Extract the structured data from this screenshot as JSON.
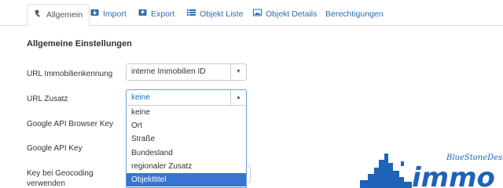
{
  "tabs": [
    {
      "label": "Allgemein",
      "icon": "wrench-icon",
      "active": true
    },
    {
      "label": "Import",
      "icon": "import-icon",
      "active": false
    },
    {
      "label": "Export",
      "icon": "export-icon",
      "active": false
    },
    {
      "label": "Objekt Liste",
      "icon": "list-icon",
      "active": false
    },
    {
      "label": "Objekt Details",
      "icon": "image-icon",
      "active": false
    },
    {
      "label": "Berechtigungen",
      "icon": "",
      "active": false
    }
  ],
  "section": {
    "title": "Allgemeine Einstellungen"
  },
  "fields": {
    "url_id": {
      "label": "URL Immobilienkennung",
      "value": "interne Immobilien ID"
    },
    "url_zusatz": {
      "label": "URL Zusatz",
      "value": "keine"
    },
    "google_browser_key": {
      "label": "Google API Browser Key"
    },
    "google_api_key": {
      "label": "Google API Key"
    },
    "geocoding": {
      "label": "Key bei Geocoding verwenden"
    }
  },
  "dropdown": {
    "options": [
      "keine",
      "Ort",
      "Straße",
      "Bundesland",
      "regionaler Zusatz",
      "Objekttitel"
    ],
    "highlighted": "Objekttitel"
  },
  "logo": {
    "text": "immo",
    "script": "BlueStoneDesign"
  },
  "colors": {
    "link": "#2a6db0",
    "highlight": "#3874d0",
    "logo": "#1f63b8"
  }
}
